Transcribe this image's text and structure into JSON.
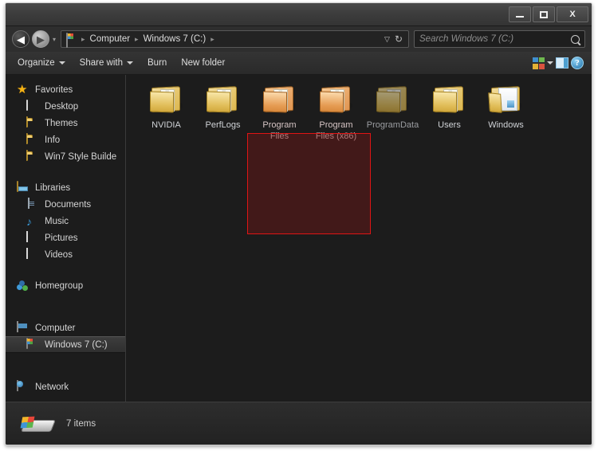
{
  "window": {
    "controls": {
      "minimize_label": "–",
      "maximize_label": "□",
      "close_label": "X"
    }
  },
  "navbar": {
    "back_glyph": "◀",
    "forward_glyph": "▶",
    "history_glyph": "▾",
    "breadcrumb": {
      "icon": "computer-drive-icon",
      "items": [
        "Computer",
        "Windows 7 (C:)"
      ],
      "separator": "▸",
      "trailing_separator": "▸"
    },
    "dropdown_glyph": "▽",
    "refresh_glyph": "↻",
    "search": {
      "placeholder": "Search Windows 7 (C:)",
      "icon": "search-magnifier-icon"
    }
  },
  "toolbar": {
    "items": [
      {
        "label": "Organize",
        "has_caret": true
      },
      {
        "label": "Share with",
        "has_caret": true
      },
      {
        "label": "Burn",
        "has_caret": false
      },
      {
        "label": "New folder",
        "has_caret": false
      }
    ],
    "right_icons": [
      {
        "name": "change-view-icon"
      },
      {
        "name": "view-dropdown-caret"
      },
      {
        "name": "preview-pane-icon"
      },
      {
        "name": "help-icon",
        "label": "?"
      }
    ]
  },
  "sidebar": {
    "groups": [
      {
        "header": {
          "label": "Favorites",
          "icon": "star-icon"
        },
        "items": [
          {
            "label": "Desktop",
            "icon": "desktop-icon"
          },
          {
            "label": "Themes",
            "icon": "folder-icon"
          },
          {
            "label": "Info",
            "icon": "folder-icon"
          },
          {
            "label": "Win7 Style Builde",
            "icon": "folder-icon"
          }
        ]
      },
      {
        "header": {
          "label": "Libraries",
          "icon": "libraries-icon"
        },
        "items": [
          {
            "label": "Documents",
            "icon": "documents-icon"
          },
          {
            "label": "Music",
            "icon": "music-note-icon"
          },
          {
            "label": "Pictures",
            "icon": "pictures-icon"
          },
          {
            "label": "Videos",
            "icon": "videos-icon"
          }
        ]
      },
      {
        "header": {
          "label": "Homegroup",
          "icon": "homegroup-icon"
        },
        "items": []
      },
      {
        "header": {
          "label": "Computer",
          "icon": "computer-icon"
        },
        "items": [
          {
            "label": "Windows 7 (C:)",
            "icon": "hard-drive-icon",
            "selected": true
          }
        ]
      },
      {
        "header": {
          "label": "Network",
          "icon": "network-icon"
        },
        "items": []
      }
    ]
  },
  "content": {
    "items": [
      {
        "name": "NVIDIA",
        "icon": "folder-icon",
        "state": "normal"
      },
      {
        "name": "PerfLogs",
        "icon": "folder-icon",
        "state": "normal"
      },
      {
        "name": "Program Files",
        "icon": "folder-icon",
        "state": "selected"
      },
      {
        "name": "Program Files (x86)",
        "icon": "folder-icon",
        "state": "selected"
      },
      {
        "name": "ProgramData",
        "icon": "folder-icon",
        "state": "dim"
      },
      {
        "name": "Users",
        "icon": "folder-icon",
        "state": "normal"
      },
      {
        "name": "Windows",
        "icon": "open-folder-icon",
        "state": "normal"
      }
    ],
    "selection_highlight": {
      "border_color": "#e01414",
      "fill_color": "#781616"
    }
  },
  "statusbar": {
    "icon": "hard-drive-icon",
    "text": "7 items"
  },
  "colors": {
    "window_background": "#1c1c1c",
    "chrome": "#2e2e2e",
    "text": "#d5d5d5",
    "accent_red": "#e01414",
    "folder_yellow": "#e8bf54",
    "folder_orange": "#e09450"
  }
}
